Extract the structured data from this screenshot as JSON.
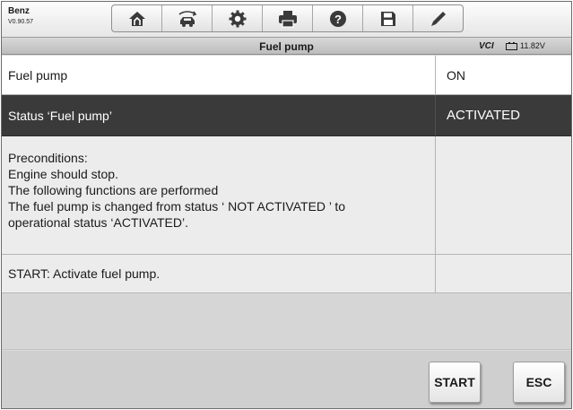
{
  "header": {
    "brand": "Benz",
    "version": "V0.90.57",
    "toolbar_icons": [
      "home-icon",
      "vehicle-swap-icon",
      "settings-icon",
      "print-icon",
      "help-icon",
      "save-icon",
      "pen-icon"
    ]
  },
  "titlebar": {
    "title": "Fuel pump",
    "vci": "VCI",
    "voltage": "11.82V"
  },
  "rows": [
    {
      "label": "Fuel pump",
      "value": "ON"
    },
    {
      "label": "Status ‘Fuel pump’",
      "value": "ACTIVATED"
    }
  ],
  "info": {
    "lines": [
      "Preconditions:",
      "Engine should stop.",
      "The following functions are performed",
      "The fuel pump is changed from status ‘ NOT ACTIVATED ’ to",
      "operational status ‘ACTIVATED’."
    ]
  },
  "action_row": {
    "label": "START: Activate fuel pump."
  },
  "buttons": {
    "start": "START",
    "esc": "ESC"
  },
  "colors": {
    "selected_row": "#3a3a3a",
    "background": "#d9d9d9"
  }
}
